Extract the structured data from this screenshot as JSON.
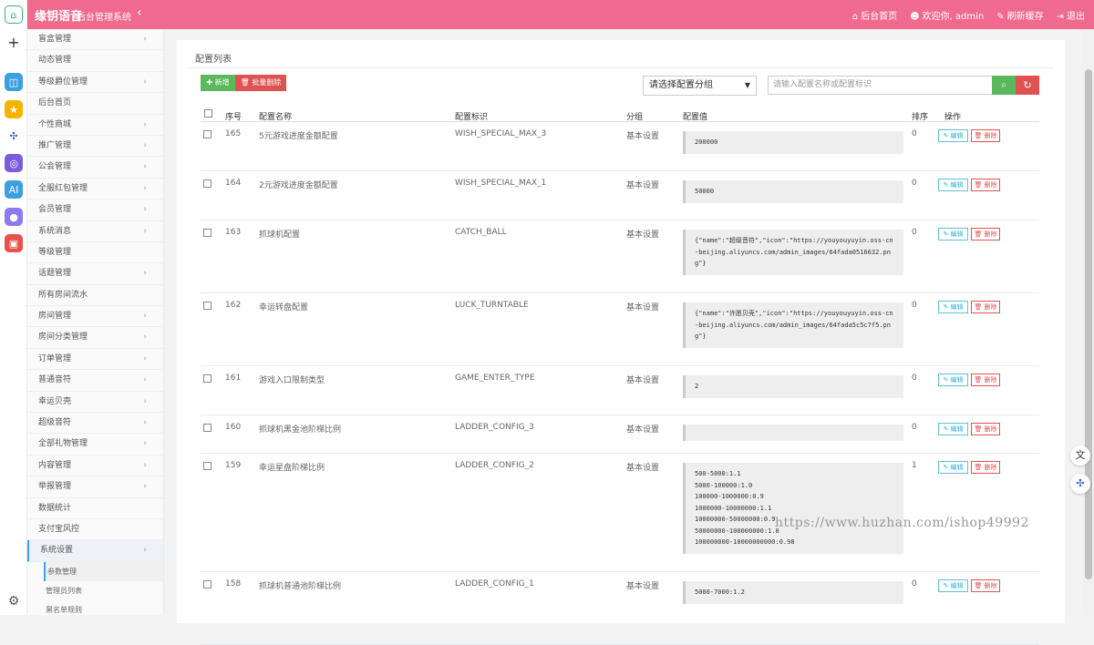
{
  "topbar": {
    "brand": "缘钥语音",
    "subtitle": "后台管理系统",
    "links": [
      {
        "icon": "home-icon",
        "label": "后台首页"
      },
      {
        "icon": "users-icon",
        "label": "欢迎你, admin"
      },
      {
        "icon": "brush-icon",
        "label": "刷新缓存"
      },
      {
        "icon": "signout-icon",
        "label": "退出"
      }
    ]
  },
  "sidebar": {
    "items": [
      {
        "label": "盲盒管理",
        "arrow": true
      },
      {
        "label": "动态管理",
        "arrow": false
      },
      {
        "label": "等级爵位管理",
        "arrow": true
      },
      {
        "label": "后台首页",
        "arrow": false
      },
      {
        "label": "个性商城",
        "arrow": true
      },
      {
        "label": "推广管理",
        "arrow": true
      },
      {
        "label": "公会管理",
        "arrow": true
      },
      {
        "label": "全服红包管理",
        "arrow": true
      },
      {
        "label": "会员管理",
        "arrow": true
      },
      {
        "label": "系统消息",
        "arrow": true
      },
      {
        "label": "等级管理",
        "arrow": false
      },
      {
        "label": "话题管理",
        "arrow": true
      },
      {
        "label": "所有房间流水",
        "arrow": false
      },
      {
        "label": "房间管理",
        "arrow": true
      },
      {
        "label": "房间分类管理",
        "arrow": true
      },
      {
        "label": "订单管理",
        "arrow": true
      },
      {
        "label": "普通音符",
        "arrow": true
      },
      {
        "label": "幸运贝壳",
        "arrow": true
      },
      {
        "label": "超级音符",
        "arrow": true
      },
      {
        "label": "全部礼物管理",
        "arrow": true
      },
      {
        "label": "内容管理",
        "arrow": true
      },
      {
        "label": "举报管理",
        "arrow": true
      },
      {
        "label": "数据统计",
        "arrow": false
      },
      {
        "label": "支付宝风控",
        "arrow": false
      },
      {
        "label": "系统设置",
        "arrow": true
      }
    ],
    "subitems": [
      "参数管理",
      "管理员列表",
      "黑名单规则"
    ]
  },
  "panel": {
    "title": "配置列表",
    "add_label": "✚ 新增",
    "bulk_delete_label": "🗑 批量删除",
    "group_select": "请选择配置分组",
    "search_placeholder": "请输入配置名称或配置标识"
  },
  "table": {
    "headers": [
      "序号",
      "配置名称",
      "配置标识",
      "分组",
      "配置值",
      "排序",
      "操作"
    ],
    "edit_label": "✎ 编辑",
    "delete_label": "🗑 删除",
    "rows": [
      {
        "id": "165",
        "name": "5元游戏进度金额配置",
        "key": "WISH_SPECIAL_MAX_3",
        "group": "基本设置",
        "value": "200000",
        "sort": "0"
      },
      {
        "id": "164",
        "name": "2元游戏进度金额配置",
        "key": "WISH_SPECIAL_MAX_1",
        "group": "基本设置",
        "value": "50000",
        "sort": "0"
      },
      {
        "id": "163",
        "name": "抓球机配置",
        "key": "CATCH_BALL",
        "group": "基本设置",
        "value": "{\"name\":\"超级音符\",\"icon\":\"https://youyouyuyin.oss-cn-beijing.aliyuncs.com/admin_images/64fada0516632.png\"}",
        "sort": "0"
      },
      {
        "id": "162",
        "name": "幸运转盘配置",
        "key": "LUCK_TURNTABLE",
        "group": "基本设置",
        "value": "{\"name\":\"许愿贝壳\",\"icon\":\"https://youyouyuyin.oss-cn-beijing.aliyuncs.com/admin_images/64fada5c5c7f5.png\"}",
        "sort": "0"
      },
      {
        "id": "161",
        "name": "游戏入口限制类型",
        "key": "GAME_ENTER_TYPE",
        "group": "基本设置",
        "value": "2",
        "sort": "0"
      },
      {
        "id": "160",
        "name": "抓球机黑金池阶梯比例",
        "key": "LADDER_CONFIG_3",
        "group": "基本设置",
        "value": "",
        "sort": "0"
      },
      {
        "id": "159",
        "name": "幸运星盘阶梯比例",
        "key": "LADDER_CONFIG_2",
        "group": "基本设置",
        "value": "500-5000:1.1\n5000-100000:1.0\n100000-1000000:0.9\n1000000-10000000:1.1\n10000000-50000000:0.9\n50000000-100000000:1.0\n100000000-10000000000:0.98",
        "sort": "1"
      },
      {
        "id": "158",
        "name": "抓球机普通池阶梯比例",
        "key": "LADDER_CONFIG_1",
        "group": "基本设置",
        "value": "5000-7000:1.2",
        "sort": "0"
      }
    ]
  },
  "watermark": "https://www.huzhan.com/ishop49992",
  "colors": {
    "topbar": "#f06a8e",
    "add": "#5cb85c",
    "delete": "#e05252",
    "edit": "#31b0d5"
  }
}
